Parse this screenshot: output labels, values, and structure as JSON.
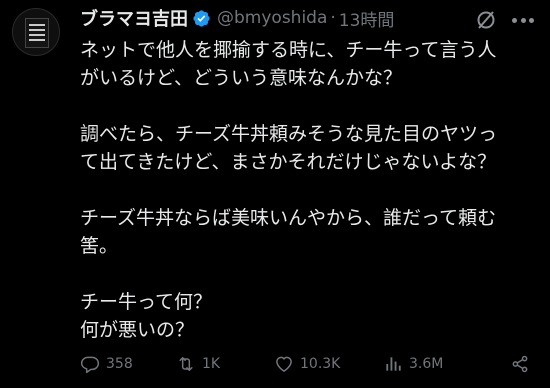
{
  "author": {
    "name": "ブラマヨ吉田",
    "handle": "@bmyoshida",
    "time": "13時間",
    "separator": "·"
  },
  "tweet": {
    "lines": [
      "ネットで他人を揶揄する時に、チー牛って言う人",
      "がいるけど、どういう意味なんかな？",
      "",
      "調べたら、チーズ牛丼頼みそうな見た目のヤツっ",
      "て出てきたけど、まさかそれだけじゃないよな？",
      "",
      "チーズ牛丼ならば美味いんやから、誰だって頼む",
      "筈。",
      "",
      "チー牛って何？",
      "何が悪いの？"
    ]
  },
  "actions": {
    "replies": "358",
    "reposts": "1K",
    "likes": "10.3K",
    "views": "3.6M"
  },
  "colors": {
    "background": "#000000",
    "text": "#e7e9ea",
    "secondary": "#71767b",
    "verified": "#1d9bf0"
  },
  "icons": [
    "avatar",
    "verified-badge-icon",
    "grok-icon",
    "more-icon",
    "reply-icon",
    "repost-icon",
    "like-icon",
    "views-icon",
    "share-icon"
  ]
}
